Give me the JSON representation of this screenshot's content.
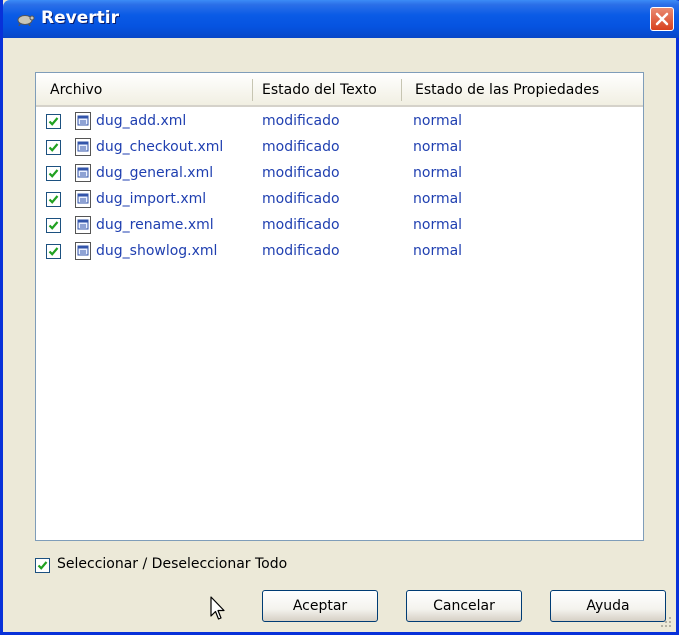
{
  "window": {
    "title": "Revertir"
  },
  "columns": [
    "Archivo",
    "Estado del Texto",
    "Estado de las Propiedades"
  ],
  "files": [
    {
      "name": "dug_add.xml",
      "text_status": "modificado",
      "prop_status": "normal",
      "checked": true
    },
    {
      "name": "dug_checkout.xml",
      "text_status": "modificado",
      "prop_status": "normal",
      "checked": true
    },
    {
      "name": "dug_general.xml",
      "text_status": "modificado",
      "prop_status": "normal",
      "checked": true
    },
    {
      "name": "dug_import.xml",
      "text_status": "modificado",
      "prop_status": "normal",
      "checked": true
    },
    {
      "name": "dug_rename.xml",
      "text_status": "modificado",
      "prop_status": "normal",
      "checked": true
    },
    {
      "name": "dug_showlog.xml",
      "text_status": "modificado",
      "prop_status": "normal",
      "checked": true
    }
  ],
  "select_all": {
    "label": "Seleccionar / Deseleccionar Todo",
    "checked": true
  },
  "buttons": {
    "ok": "Aceptar",
    "cancel": "Cancelar",
    "help": "Ayuda"
  },
  "colors": {
    "title_bar": "#0A5BE6",
    "link_text": "#1F3FB0",
    "check": "#21A121"
  }
}
